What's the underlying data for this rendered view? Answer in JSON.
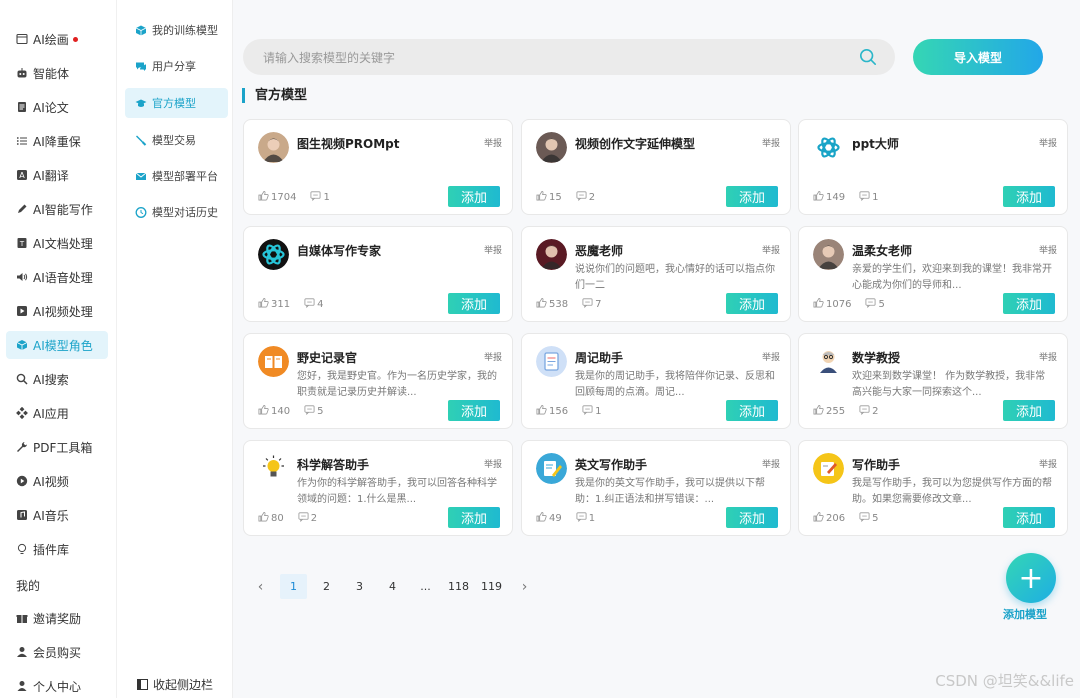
{
  "left_nav": {
    "items": [
      {
        "label": "AI绘画",
        "icon": "image-icon",
        "dot": true
      },
      {
        "label": "智能体",
        "icon": "robot-icon"
      },
      {
        "label": "AI论文",
        "icon": "document-icon"
      },
      {
        "label": "AI降重保",
        "icon": "list-icon"
      },
      {
        "label": "AI翻译",
        "icon": "translate-icon"
      },
      {
        "label": "AI智能写作",
        "icon": "pen-icon"
      },
      {
        "label": "AI文档处理",
        "icon": "doc-process-icon"
      },
      {
        "label": "AI语音处理",
        "icon": "speaker-icon"
      },
      {
        "label": "AI视频处理",
        "icon": "video-icon"
      },
      {
        "label": "AI模型角色",
        "icon": "cube-icon",
        "active": true
      },
      {
        "label": "AI搜索",
        "icon": "search-icon"
      },
      {
        "label": "AI应用",
        "icon": "apps-icon"
      },
      {
        "label": "PDF工具箱",
        "icon": "wrench-icon"
      },
      {
        "label": "AI视频",
        "icon": "play-icon"
      },
      {
        "label": "AI音乐",
        "icon": "music-icon"
      },
      {
        "label": "插件库",
        "icon": "bulb-icon"
      }
    ],
    "section_label": "我的",
    "my_items": [
      {
        "label": "邀请奖励",
        "icon": "gift-icon"
      },
      {
        "label": "会员购买",
        "icon": "user-icon"
      },
      {
        "label": "个人中心",
        "icon": "person-icon"
      }
    ]
  },
  "sub_nav": {
    "items": [
      {
        "label": "我的训练模型",
        "icon": "cube-icon"
      },
      {
        "label": "用户分享",
        "icon": "chat-icon"
      },
      {
        "label": "官方模型",
        "icon": "graduation-cap-icon",
        "active": true
      },
      {
        "label": "模型交易",
        "icon": "brush-icon"
      },
      {
        "label": "模型部署平台",
        "icon": "mail-icon"
      },
      {
        "label": "模型对话历史",
        "icon": "clock-icon"
      }
    ],
    "collapse_label": "收起侧边栏"
  },
  "search": {
    "placeholder": "请输入搜索模型的关键字"
  },
  "import_button": "导入模型",
  "section_title": "官方模型",
  "cards": [
    {
      "name": "图生视频PROMpt",
      "desc": "",
      "likes": "1704",
      "comments": "1",
      "avatar": "photo-person-icon",
      "color": "#c9a98a"
    },
    {
      "name": "视频创作文字延伸模型",
      "desc": "",
      "likes": "15",
      "comments": "2",
      "avatar": "photo-woman-icon",
      "color": "#6b5a55"
    },
    {
      "name": "ppt大师",
      "desc": "",
      "likes": "149",
      "comments": "1",
      "avatar": "openai-logo-icon",
      "color": "#19a4c7"
    },
    {
      "name": "自媒体写作专家",
      "desc": "",
      "likes": "311",
      "comments": "4",
      "avatar": "openai-logo-dark-icon",
      "color": "#1a1a1a"
    },
    {
      "name": "恶魔老师",
      "desc": "说说你们的问题吧，我心情好的话可以指点你们一二",
      "likes": "538",
      "comments": "7",
      "avatar": "photo-demon-icon",
      "color": "#5a1a24"
    },
    {
      "name": "温柔女老师",
      "desc": "亲爱的学生们，欢迎来到我的课堂！我非常开心能成为你们的导师和...",
      "likes": "1076",
      "comments": "5",
      "avatar": "photo-teacher-icon",
      "color": "#9a8478"
    },
    {
      "name": "野史记录官",
      "desc": "您好，我是野史官。作为一名历史学家，我的职责就是记录历史并解读...",
      "likes": "140",
      "comments": "5",
      "avatar": "book-icon",
      "color": "#f08a24"
    },
    {
      "name": "周记助手",
      "desc": "我是你的周记助手，我将陪伴你记录、反思和回顾每周的点滴。周记...",
      "likes": "156",
      "comments": "1",
      "avatar": "notepad-icon",
      "color": "#7aa7e0"
    },
    {
      "name": "数学教授",
      "desc": "欢迎来到数学课堂！ 作为数学教授，我非常高兴能与大家一同探索这个...",
      "likes": "255",
      "comments": "2",
      "avatar": "professor-icon",
      "color": "#d9c2a6"
    },
    {
      "name": "科学解答助手",
      "desc": "作为你的科学解答助手，我可以回答各种科学领域的问题：1.什么是黑...",
      "likes": "80",
      "comments": "2",
      "avatar": "lightbulb-icon",
      "color": "#f5c518"
    },
    {
      "name": "英文写作助手",
      "desc": "我是你的英文写作助手，我可以提供以下帮助：1.纠正语法和拼写错误：...",
      "likes": "49",
      "comments": "1",
      "avatar": "writing-icon",
      "color": "#3aa8d8"
    },
    {
      "name": "写作助手",
      "desc": "我是写作助手，我可以为您提供写作方面的帮助。如果您需要修改文章...",
      "likes": "206",
      "comments": "5",
      "avatar": "pencil-paper-icon",
      "color": "#f5c518"
    }
  ],
  "card_report_label": "举报",
  "card_add_label": "添加",
  "pagination": {
    "prev": "‹",
    "pages": [
      "1",
      "2",
      "3",
      "4",
      "...",
      "118",
      "119"
    ],
    "next": "›",
    "current": "1"
  },
  "fab_label": "添加模型",
  "fab_symbol": "+",
  "watermark": "CSDN @坦笑&&life"
}
